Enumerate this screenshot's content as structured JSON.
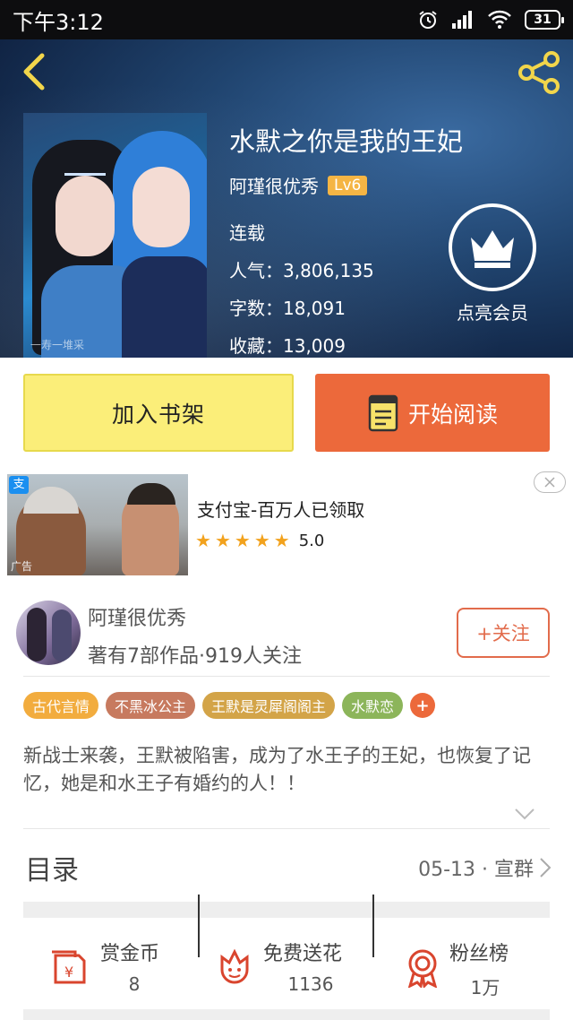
{
  "status_bar": {
    "time": "下午3:12",
    "battery": "31"
  },
  "book": {
    "title": "水默之你是我的王妃",
    "author": "阿瑾很优秀",
    "level": "Lv6",
    "status": "连载",
    "popularity": "人气：3,806,135",
    "word_count": "字数：18,091",
    "favorites": "收藏：13,009",
    "cover_watermark": "一寿一堆采"
  },
  "vip": {
    "label": "点亮会员"
  },
  "actions": {
    "add_to_shelf": "加入书架",
    "start_reading": "开始阅读"
  },
  "ad": {
    "title": "支付宝-百万人已领取",
    "rating": "5.0",
    "close_icon": "close-icon",
    "logo_text": "支",
    "tag": "广告"
  },
  "author_profile": {
    "name": "阿瑾很优秀",
    "stats": "著有7部作品·919人关注",
    "follow_button": "+关注"
  },
  "tags": [
    {
      "label": "古代言情",
      "color": "#f2ac3e"
    },
    {
      "label": "不黑冰公主",
      "color": "#c77a5f"
    },
    {
      "label": "王默是灵犀阁阁主",
      "color": "#d3a448"
    },
    {
      "label": "水默恋",
      "color": "#8cb55a"
    }
  ],
  "synopsis": "新战士来袭，王默被陷害，成为了水王子的王妃，也恢复了记忆，她是和水王子有婚约的人！！",
  "toc": {
    "label": "目录",
    "meta": "05-13 · 宣群"
  },
  "stats": [
    {
      "label": "赏金币",
      "value": "8",
      "icon": "reward-coin-icon"
    },
    {
      "label": "免费送花",
      "value": "1136",
      "icon": "flower-icon"
    },
    {
      "label": "粉丝榜",
      "value": "1万",
      "icon": "ribbon-medal-icon"
    }
  ],
  "colors": {
    "accent": "#ec693b",
    "shelf_button": "#fbee79",
    "lv_badge": "#f5b544"
  }
}
